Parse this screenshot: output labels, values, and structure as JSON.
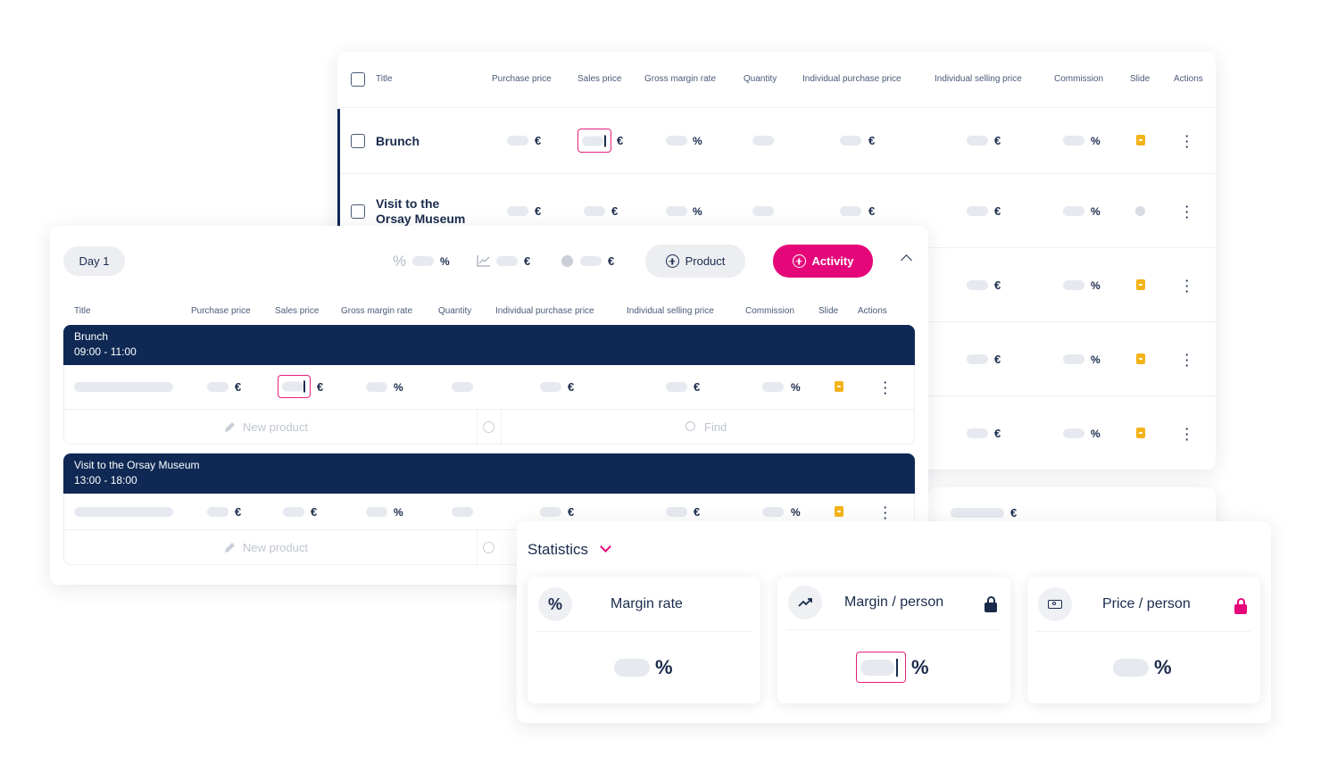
{
  "back_table": {
    "headers": [
      "Title",
      "Purchase price",
      "Sales price",
      "Gross margin rate",
      "Quantity",
      "Individual purchase price",
      "Individual selling price",
      "Commission",
      "Slide",
      "Actions"
    ],
    "rows": [
      {
        "title": "Brunch"
      },
      {
        "title_line1": "Visit to the",
        "title_line2": "Orsay Museum"
      }
    ],
    "currency": "€",
    "percent": "%"
  },
  "day_panel": {
    "day_label": "Day 1",
    "summary_percent": "%",
    "summary_currency": "€",
    "product_button": "Product",
    "activity_button": "Activity",
    "headers": [
      "Title",
      "Purchase price",
      "Sales price",
      "Gross margin rate",
      "Quantity",
      "Individual purchase price",
      "Individual selling price",
      "Commission",
      "Slide",
      "Actions"
    ],
    "groups": [
      {
        "name": "Brunch",
        "time": "09:00 - 11:00"
      },
      {
        "name": "Visit to the Orsay Museum",
        "time": "13:00 - 18:00"
      }
    ],
    "new_product": "New product",
    "find": "Find",
    "currency": "€",
    "percent": "%"
  },
  "statistics": {
    "title": "Statistics",
    "cards": [
      {
        "label": "Margin rate",
        "unit": "%"
      },
      {
        "label": "Margin / person",
        "unit": "%"
      },
      {
        "label": "Price / person",
        "unit": "%"
      }
    ]
  },
  "colors": {
    "navy": "#0f2954",
    "accent": "#e5077a",
    "slide": "#f3b31a"
  }
}
